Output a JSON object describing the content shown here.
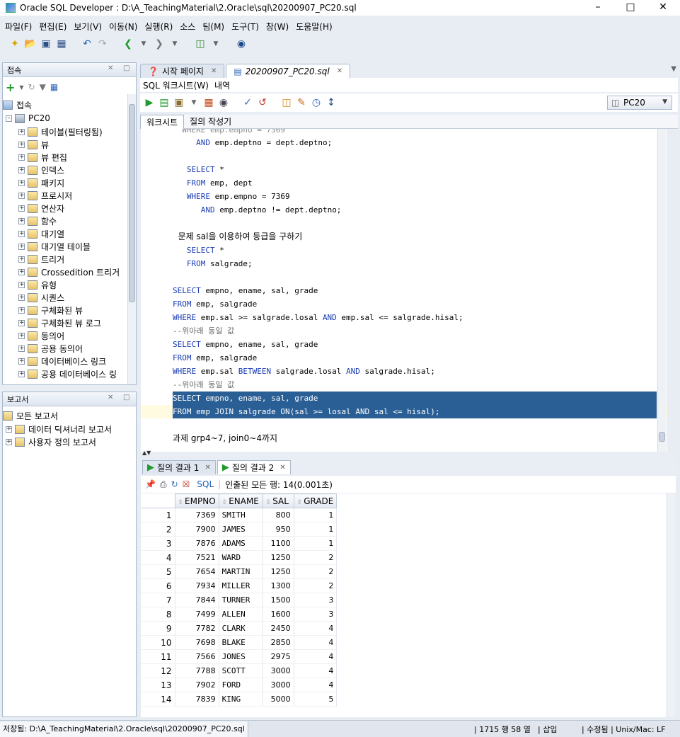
{
  "window": {
    "title": "Oracle SQL Developer : D:\\A_TeachingMaterial\\2.Oracle\\sql\\20200907_PC20.sql"
  },
  "menu": [
    "파일(F)",
    "편집(E)",
    "보기(V)",
    "이동(N)",
    "실행(R)",
    "소스",
    "팀(M)",
    "도구(T)",
    "창(W)",
    "도움말(H)"
  ],
  "connections_panel": {
    "title": "접속",
    "root_label": "접속",
    "connection": "PC20",
    "items": [
      "테이블(필터링됨)",
      "뷰",
      "뷰 편집",
      "인덱스",
      "패키지",
      "프로시저",
      "연산자",
      "함수",
      "대기열",
      "대기열 테이블",
      "트리거",
      "Crossedition 트리거",
      "유형",
      "시퀀스",
      "구체화된 뷰",
      "구체화된 뷰 로그",
      "동의어",
      "공용 동의어",
      "데이터베이스 링크",
      "공용 데이터베이스 링"
    ]
  },
  "reports_panel": {
    "title": "보고서",
    "root_label": "모든 보고서",
    "items": [
      "데이터 딕셔너리 보고서",
      "사용자 정의 보고서"
    ]
  },
  "doc_tabs": [
    {
      "label": "시작 페이지"
    },
    {
      "label": "20200907_PC20.sql"
    }
  ],
  "sub_tabs": [
    "SQL 워크시트(W)",
    "내역"
  ],
  "connection_select": "PC20",
  "worksheet_tabs": [
    "워크시트",
    "질의 작성기"
  ],
  "editor_lines": [
    {
      "text": "     AND emp.deptno = dept.deptno;",
      "kind": "code"
    },
    {
      "text": "",
      "kind": "code"
    },
    {
      "text": "   SELECT *",
      "kind": "code"
    },
    {
      "text": "   FROM emp, dept",
      "kind": "code"
    },
    {
      "text": "   WHERE emp.empno = 7369",
      "kind": "code"
    },
    {
      "text": "      AND emp.deptno != dept.deptno;",
      "kind": "code"
    },
    {
      "text": "",
      "kind": "code"
    },
    {
      "text": "  문제 sal을 이용하여 등급을 구하기",
      "kind": "note"
    },
    {
      "text": "   SELECT *",
      "kind": "code"
    },
    {
      "text": "   FROM salgrade;",
      "kind": "code"
    },
    {
      "text": "",
      "kind": "code"
    },
    {
      "text": "SELECT empno, ename, sal, grade",
      "kind": "code"
    },
    {
      "text": "FROM emp, salgrade",
      "kind": "code"
    },
    {
      "text": "WHERE emp.sal >= salgrade.losal AND emp.sal <= salgrade.hisal;",
      "kind": "code"
    },
    {
      "text": "--위아래 동일 값",
      "kind": "comment"
    },
    {
      "text": "SELECT empno, ename, sal, grade",
      "kind": "code"
    },
    {
      "text": "FROM emp, salgrade",
      "kind": "code"
    },
    {
      "text": "WHERE emp.sal BETWEEN salgrade.losal AND salgrade.hisal;",
      "kind": "code"
    },
    {
      "text": "--위아래 동일 값",
      "kind": "comment"
    },
    {
      "text": "SELECT empno, ename, sal, grade",
      "kind": "hl"
    },
    {
      "text": "FROM emp JOIN salgrade ON(sal >= losal AND sal <= hisal);",
      "kind": "hl"
    },
    {
      "text": "",
      "kind": "code"
    },
    {
      "text": "과제 grp4~7, join0~4까지",
      "kind": "note"
    }
  ],
  "result_tabs": [
    "질의 결과 1",
    "질의 결과 2"
  ],
  "result_toolbar": {
    "sql_label": "SQL",
    "fetch_status": "인출된 모든 행: 14(0.001초)"
  },
  "result_grid": {
    "columns": [
      "EMPNO",
      "ENAME",
      "SAL",
      "GRADE"
    ],
    "rows": [
      [
        "1",
        "7369",
        "SMITH",
        "800",
        "1"
      ],
      [
        "2",
        "7900",
        "JAMES",
        "950",
        "1"
      ],
      [
        "3",
        "7876",
        "ADAMS",
        "1100",
        "1"
      ],
      [
        "4",
        "7521",
        "WARD",
        "1250",
        "2"
      ],
      [
        "5",
        "7654",
        "MARTIN",
        "1250",
        "2"
      ],
      [
        "6",
        "7934",
        "MILLER",
        "1300",
        "2"
      ],
      [
        "7",
        "7844",
        "TURNER",
        "1500",
        "3"
      ],
      [
        "8",
        "7499",
        "ALLEN",
        "1600",
        "3"
      ],
      [
        "9",
        "7782",
        "CLARK",
        "2450",
        "4"
      ],
      [
        "10",
        "7698",
        "BLAKE",
        "2850",
        "4"
      ],
      [
        "11",
        "7566",
        "JONES",
        "2975",
        "4"
      ],
      [
        "12",
        "7788",
        "SCOTT",
        "3000",
        "4"
      ],
      [
        "13",
        "7902",
        "FORD",
        "3000",
        "4"
      ],
      [
        "14",
        "7839",
        "KING",
        "5000",
        "5"
      ]
    ]
  },
  "status": {
    "saved_path": "저장됨: D:\\A_TeachingMaterial\\2.Oracle\\sql\\20200907_PC20.sql",
    "position": "1715 행 58 열",
    "insert_mode": "삽입",
    "modified": "수정됨",
    "line_endings": "Unix/Mac: LF"
  },
  "colors": {
    "selection": "#2a5f96",
    "keyword": "#1a3cb3",
    "panel_border": "#a9b8cc"
  }
}
